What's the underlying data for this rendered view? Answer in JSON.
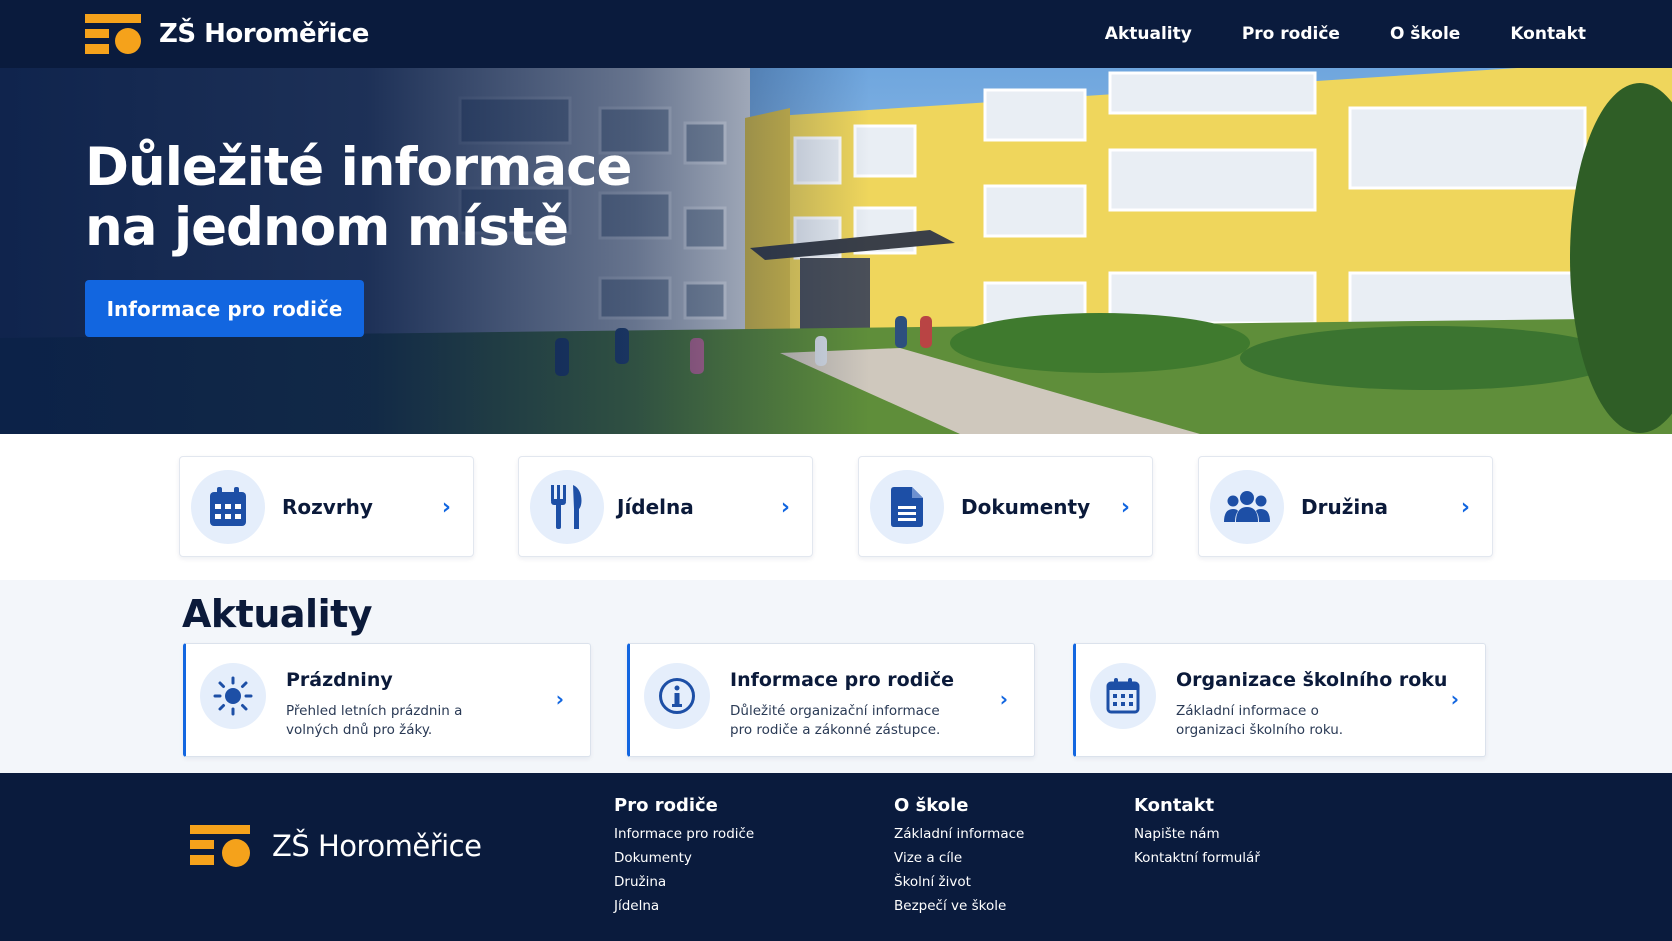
{
  "site": {
    "name": "ZŠ Horoměřice"
  },
  "nav": {
    "items": [
      "Aktuality",
      "Pro rodiče",
      "O škole",
      "Kontakt"
    ]
  },
  "hero": {
    "title_line1": "Důležité informace",
    "title_line2": "na jednom místě",
    "button_label": "Informace pro rodiče"
  },
  "quick_links": [
    {
      "label": "Rozvrhy",
      "icon": "calendar-icon"
    },
    {
      "label": "Jídelna",
      "icon": "cutlery-icon"
    },
    {
      "label": "Dokumenty",
      "icon": "document-icon"
    },
    {
      "label": "Družina",
      "icon": "group-icon"
    }
  ],
  "news": {
    "title": "Aktuality",
    "items": [
      {
        "title": "Prázdniny",
        "desc": "Přehled letních prázdnin a volných dnů pro žáky.",
        "icon": "sun-icon"
      },
      {
        "title": "Informace pro rodiče",
        "desc": "Důležité organizační informace pro rodiče a zákonné zástupce.",
        "icon": "info-icon"
      },
      {
        "title": "Organizace školního roku",
        "desc": "Základní informace o organizaci školního roku.",
        "icon": "calendar-icon"
      }
    ]
  },
  "footer": {
    "columns": [
      {
        "heading": "Pro rodiče",
        "links": [
          "Informace pro rodiče",
          "Dokumenty",
          "Družina",
          "Jídelna"
        ]
      },
      {
        "heading": "O škole",
        "links": [
          "Základní informace",
          "Vize a cíle",
          "Školní život",
          "Bezpečí ve škole"
        ]
      },
      {
        "heading": "Kontakt",
        "links": [
          "Napište nám",
          "Kontaktní formulář"
        ]
      }
    ]
  },
  "colors": {
    "navy": "#0a1b3d",
    "accent": "#1266e0",
    "logo": "#f5a21b",
    "building": "#f0d95a"
  }
}
